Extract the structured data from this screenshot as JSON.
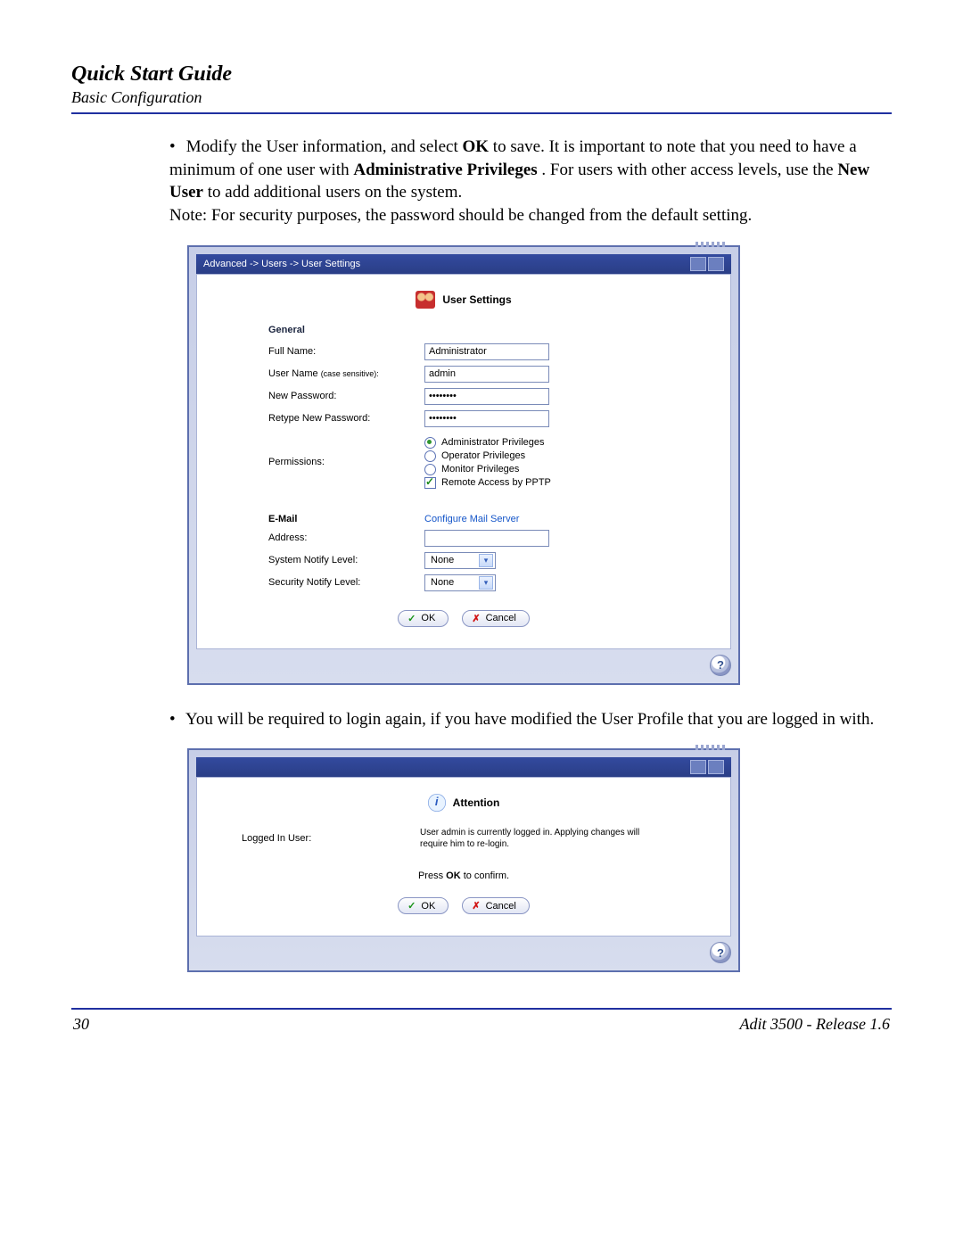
{
  "header": {
    "title": "Quick Start Guide",
    "subtitle": "Basic Configuration"
  },
  "bullets": {
    "b1_pre": "Modify the User information, and select ",
    "b1_ok": "OK",
    "b1_mid1": " to save. It is important to note that you need to have a minimum of one user with ",
    "b1_admin": "Administrative Privileges",
    "b1_mid2": ". For users with other access levels, use the ",
    "b1_newuser": "New User",
    "b1_tail": " to add additional users on the system.",
    "b1_note": "Note: For security purposes, the password should be changed from the default setting.",
    "b2": "You will be required to login again, if you have modified the User Profile that you are logged in with."
  },
  "panel1": {
    "breadcrumb": "Advanced -> Users -> User Settings",
    "title": "User Settings",
    "sections": {
      "general": "General",
      "email": "E-Mail"
    },
    "labels": {
      "full_name": "Full Name:",
      "user_name": "User Name",
      "user_name_hint": "(case sensitive):",
      "new_pw": "New Password:",
      "retype_pw": "Retype New Password:",
      "permissions": "Permissions:",
      "configure_mail": "Configure Mail Server",
      "address": "Address:",
      "sys_notify": "System Notify Level:",
      "sec_notify": "Security Notify Level:"
    },
    "values": {
      "full_name": "Administrator",
      "user_name": "admin",
      "new_pw": "••••••••",
      "retype_pw": "••••••••",
      "address": "",
      "sys_notify": "None",
      "sec_notify": "None"
    },
    "permissions": {
      "admin": "Administrator Privileges",
      "operator": "Operator Privileges",
      "monitor": "Monitor Privileges",
      "remote": "Remote Access by PPTP"
    },
    "buttons": {
      "ok": "OK",
      "cancel": "Cancel"
    }
  },
  "panel2": {
    "title": "Attention",
    "labels": {
      "logged_in": "Logged In User:"
    },
    "message": "User admin is currently logged in. Applying changes will require him to re-login.",
    "press_ok_pre": "Press ",
    "press_ok_bold": "OK",
    "press_ok_post": " to confirm.",
    "buttons": {
      "ok": "OK",
      "cancel": "Cancel"
    }
  },
  "footer": {
    "page": "30",
    "product": "Adit 3500  - Release 1.6"
  }
}
